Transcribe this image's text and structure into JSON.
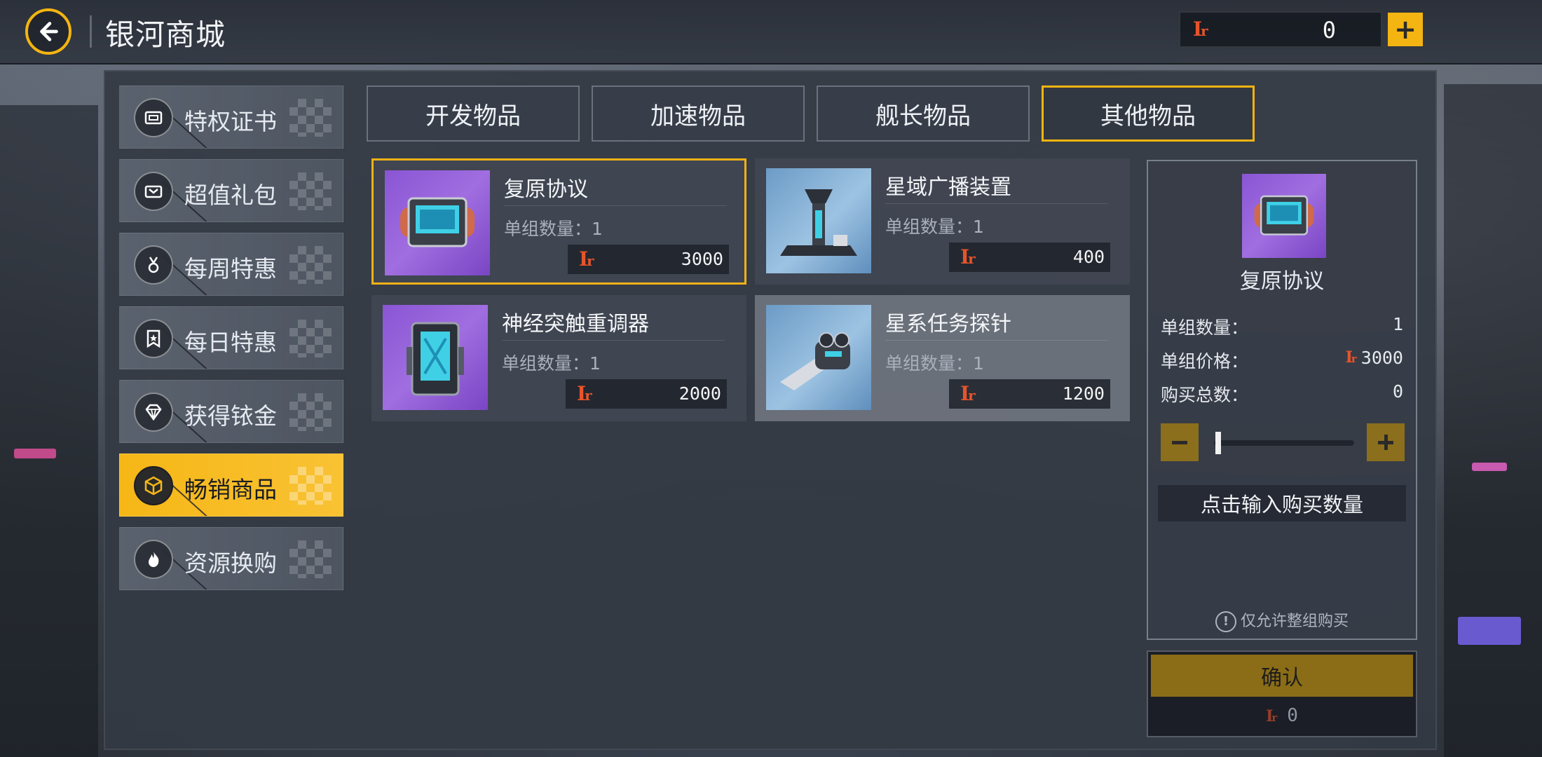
{
  "header": {
    "title": "银河商城",
    "currency_symbol": "Ir",
    "currency_amount": "0",
    "add_label": "+"
  },
  "sidebar": {
    "items": [
      {
        "label": "特权证书",
        "icon": "certificate-icon",
        "active": false
      },
      {
        "label": "超值礼包",
        "icon": "gift-pack-icon",
        "active": false
      },
      {
        "label": "每周特惠",
        "icon": "medal-icon",
        "active": false
      },
      {
        "label": "每日特惠",
        "icon": "star-badge-icon",
        "active": false
      },
      {
        "label": "获得铱金",
        "icon": "diamond-icon",
        "active": false
      },
      {
        "label": "畅销商品",
        "icon": "box-icon",
        "active": true
      },
      {
        "label": "资源换购",
        "icon": "flame-icon",
        "active": false
      }
    ]
  },
  "tabs": [
    {
      "label": "开发物品",
      "active": false
    },
    {
      "label": "加速物品",
      "active": false
    },
    {
      "label": "舰长物品",
      "active": false
    },
    {
      "label": "其他物品",
      "active": true
    }
  ],
  "items": [
    {
      "name": "复原协议",
      "qty": "单组数量：1",
      "price": "3000",
      "thumb": "purple",
      "icon": "restore-protocol-icon"
    },
    {
      "name": "星域广播装置",
      "qty": "单组数量：1",
      "price": "400",
      "thumb": "blue",
      "icon": "broadcast-tower-icon"
    },
    {
      "name": "神经突触重调器",
      "qty": "单组数量：1",
      "price": "2000",
      "thumb": "purple",
      "icon": "synapse-device-icon"
    },
    {
      "name": "星系任务探针",
      "qty": "单组数量：1",
      "price": "1200",
      "thumb": "blue",
      "icon": "probe-icon"
    }
  ],
  "detail": {
    "name": "复原协议",
    "unit_qty_label": "单组数量：",
    "unit_qty_value": "1",
    "unit_price_label": "单组价格：",
    "unit_price_value": "3000",
    "total_label": "购买总数：",
    "total_value": "0",
    "input_placeholder": "点击输入购买数量",
    "notice": "仅允许整组购买",
    "slider_value": 0
  },
  "confirm": {
    "label": "确认",
    "cost": "0"
  },
  "colors": {
    "accent": "#f4b411",
    "currency": "#e8542a",
    "confirm_bg": "#8b6d17"
  }
}
